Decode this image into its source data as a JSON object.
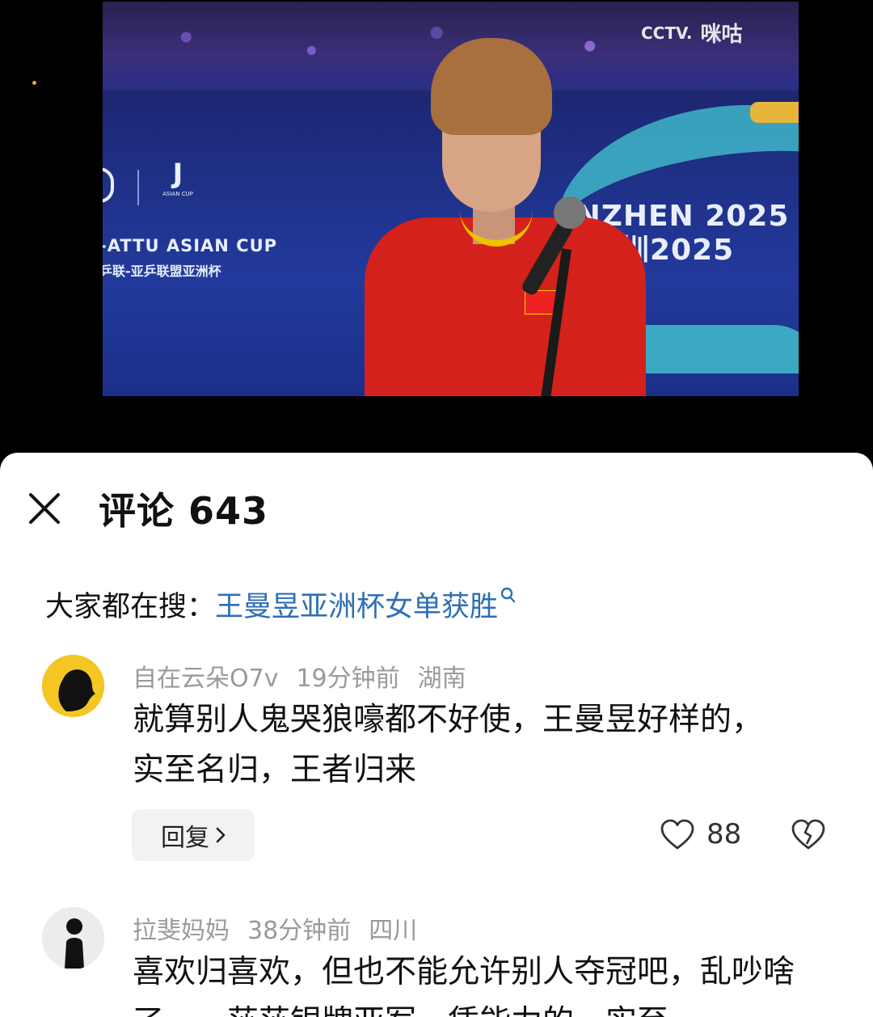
{
  "video": {
    "broadcaster": "CCTV.",
    "platform": "咪咕",
    "event_title_en": "-ATTU ASIAN CUP",
    "event_title_cn": "乒联-亚乒联盟亚洲杯",
    "city_line1": "ENZHEN 2025",
    "city_line2": "圳2025",
    "event_logo_sub": "ASIAN CUP"
  },
  "comments_panel": {
    "title": "评论 643",
    "hot_search_label": "大家都在搜：",
    "hot_search_term": "王曼昱亚洲杯女单获胜",
    "comments": [
      {
        "username": "自在云朵O7v",
        "time": "19分钟前",
        "location": "湖南",
        "text": "就算别人鬼哭狼嚎都不好使，王曼昱好样的，实至名归，王者归来",
        "reply_label": "回复",
        "likes": "88"
      },
      {
        "username": "拉斐妈妈",
        "time": "38分钟前",
        "location": "四川",
        "text": "喜欢归喜欢，但也不能允许别人夺冠吧，乱吵啥了……莎莎银牌亚军，凭能力的，实至"
      }
    ]
  },
  "colors": {
    "link_blue": "#2e6fb4",
    "meta_gray": "#9a9a9a",
    "reply_bg": "#f2f2f2"
  }
}
